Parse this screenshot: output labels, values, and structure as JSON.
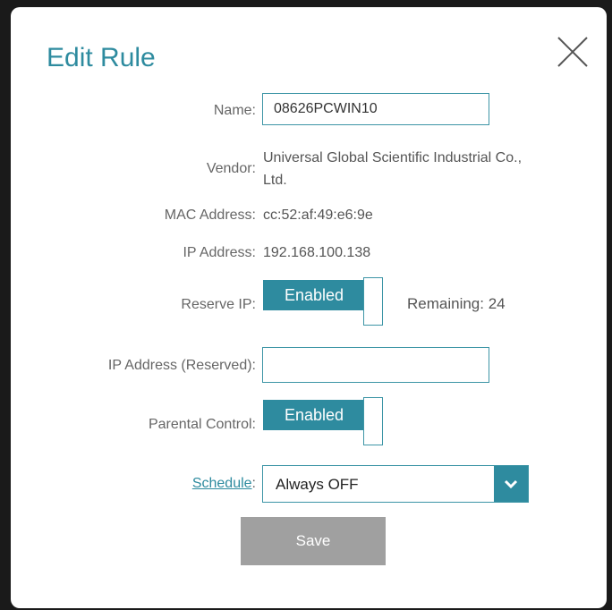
{
  "dialog": {
    "title": "Edit Rule",
    "name": {
      "label": "Name:",
      "value": "08626PCWIN10"
    },
    "vendor": {
      "label": "Vendor:",
      "value_line1": "Universal Global Scientific Industrial Co.,",
      "value_line2": "Ltd."
    },
    "mac": {
      "label": "MAC Address:",
      "value": "cc:52:af:49:e6:9e"
    },
    "ip": {
      "label": "IP Address:",
      "value": "192.168.100.138"
    },
    "reserve_ip": {
      "label": "Reserve IP:",
      "state": "Enabled",
      "remaining": "Remaining: 24"
    },
    "ip_reserved": {
      "label": "IP Address (Reserved):",
      "value": ""
    },
    "parental_control": {
      "label": "Parental Control:",
      "state": "Enabled"
    },
    "schedule": {
      "label": "Schedule",
      "colon": ":",
      "value": "Always OFF"
    },
    "save_label": "Save"
  },
  "colors": {
    "accent": "#2e8b9f",
    "save_disabled": "#a0a0a0"
  }
}
